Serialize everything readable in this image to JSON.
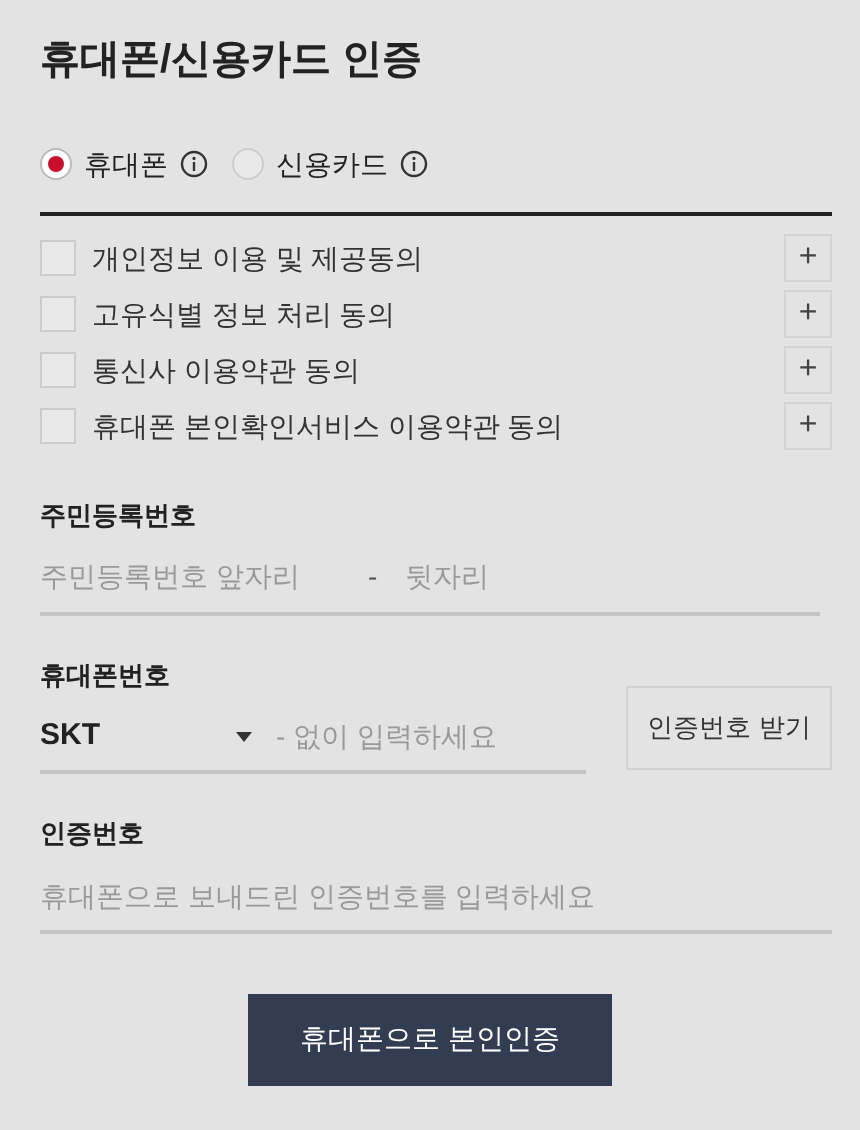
{
  "title": "휴대폰/신용카드 인증",
  "methods": [
    {
      "label": "휴대폰",
      "selected": true
    },
    {
      "label": "신용카드",
      "selected": false
    }
  ],
  "agreements": [
    {
      "label": "개인정보 이용 및 제공동의",
      "checked": false,
      "expand": "+"
    },
    {
      "label": "고유식별 정보 처리 동의",
      "checked": false,
      "expand": "+"
    },
    {
      "label": "통신사 이용약관 동의",
      "checked": false,
      "expand": "+"
    },
    {
      "label": "휴대폰 본인확인서비스 이용약관 동의",
      "checked": false,
      "expand": "+"
    }
  ],
  "resident": {
    "label": "주민등록번호",
    "front_placeholder": "주민등록번호 앞자리",
    "separator": "-",
    "back_placeholder": "뒷자리"
  },
  "phone": {
    "label": "휴대폰번호",
    "carrier": "SKT",
    "placeholder": "- 없이 입력하세요",
    "button": "인증번호 받기"
  },
  "code": {
    "label": "인증번호",
    "placeholder": "휴대폰으로 보내드린 인증번호를 입력하세요"
  },
  "submit": "휴대폰으로 본인인증"
}
